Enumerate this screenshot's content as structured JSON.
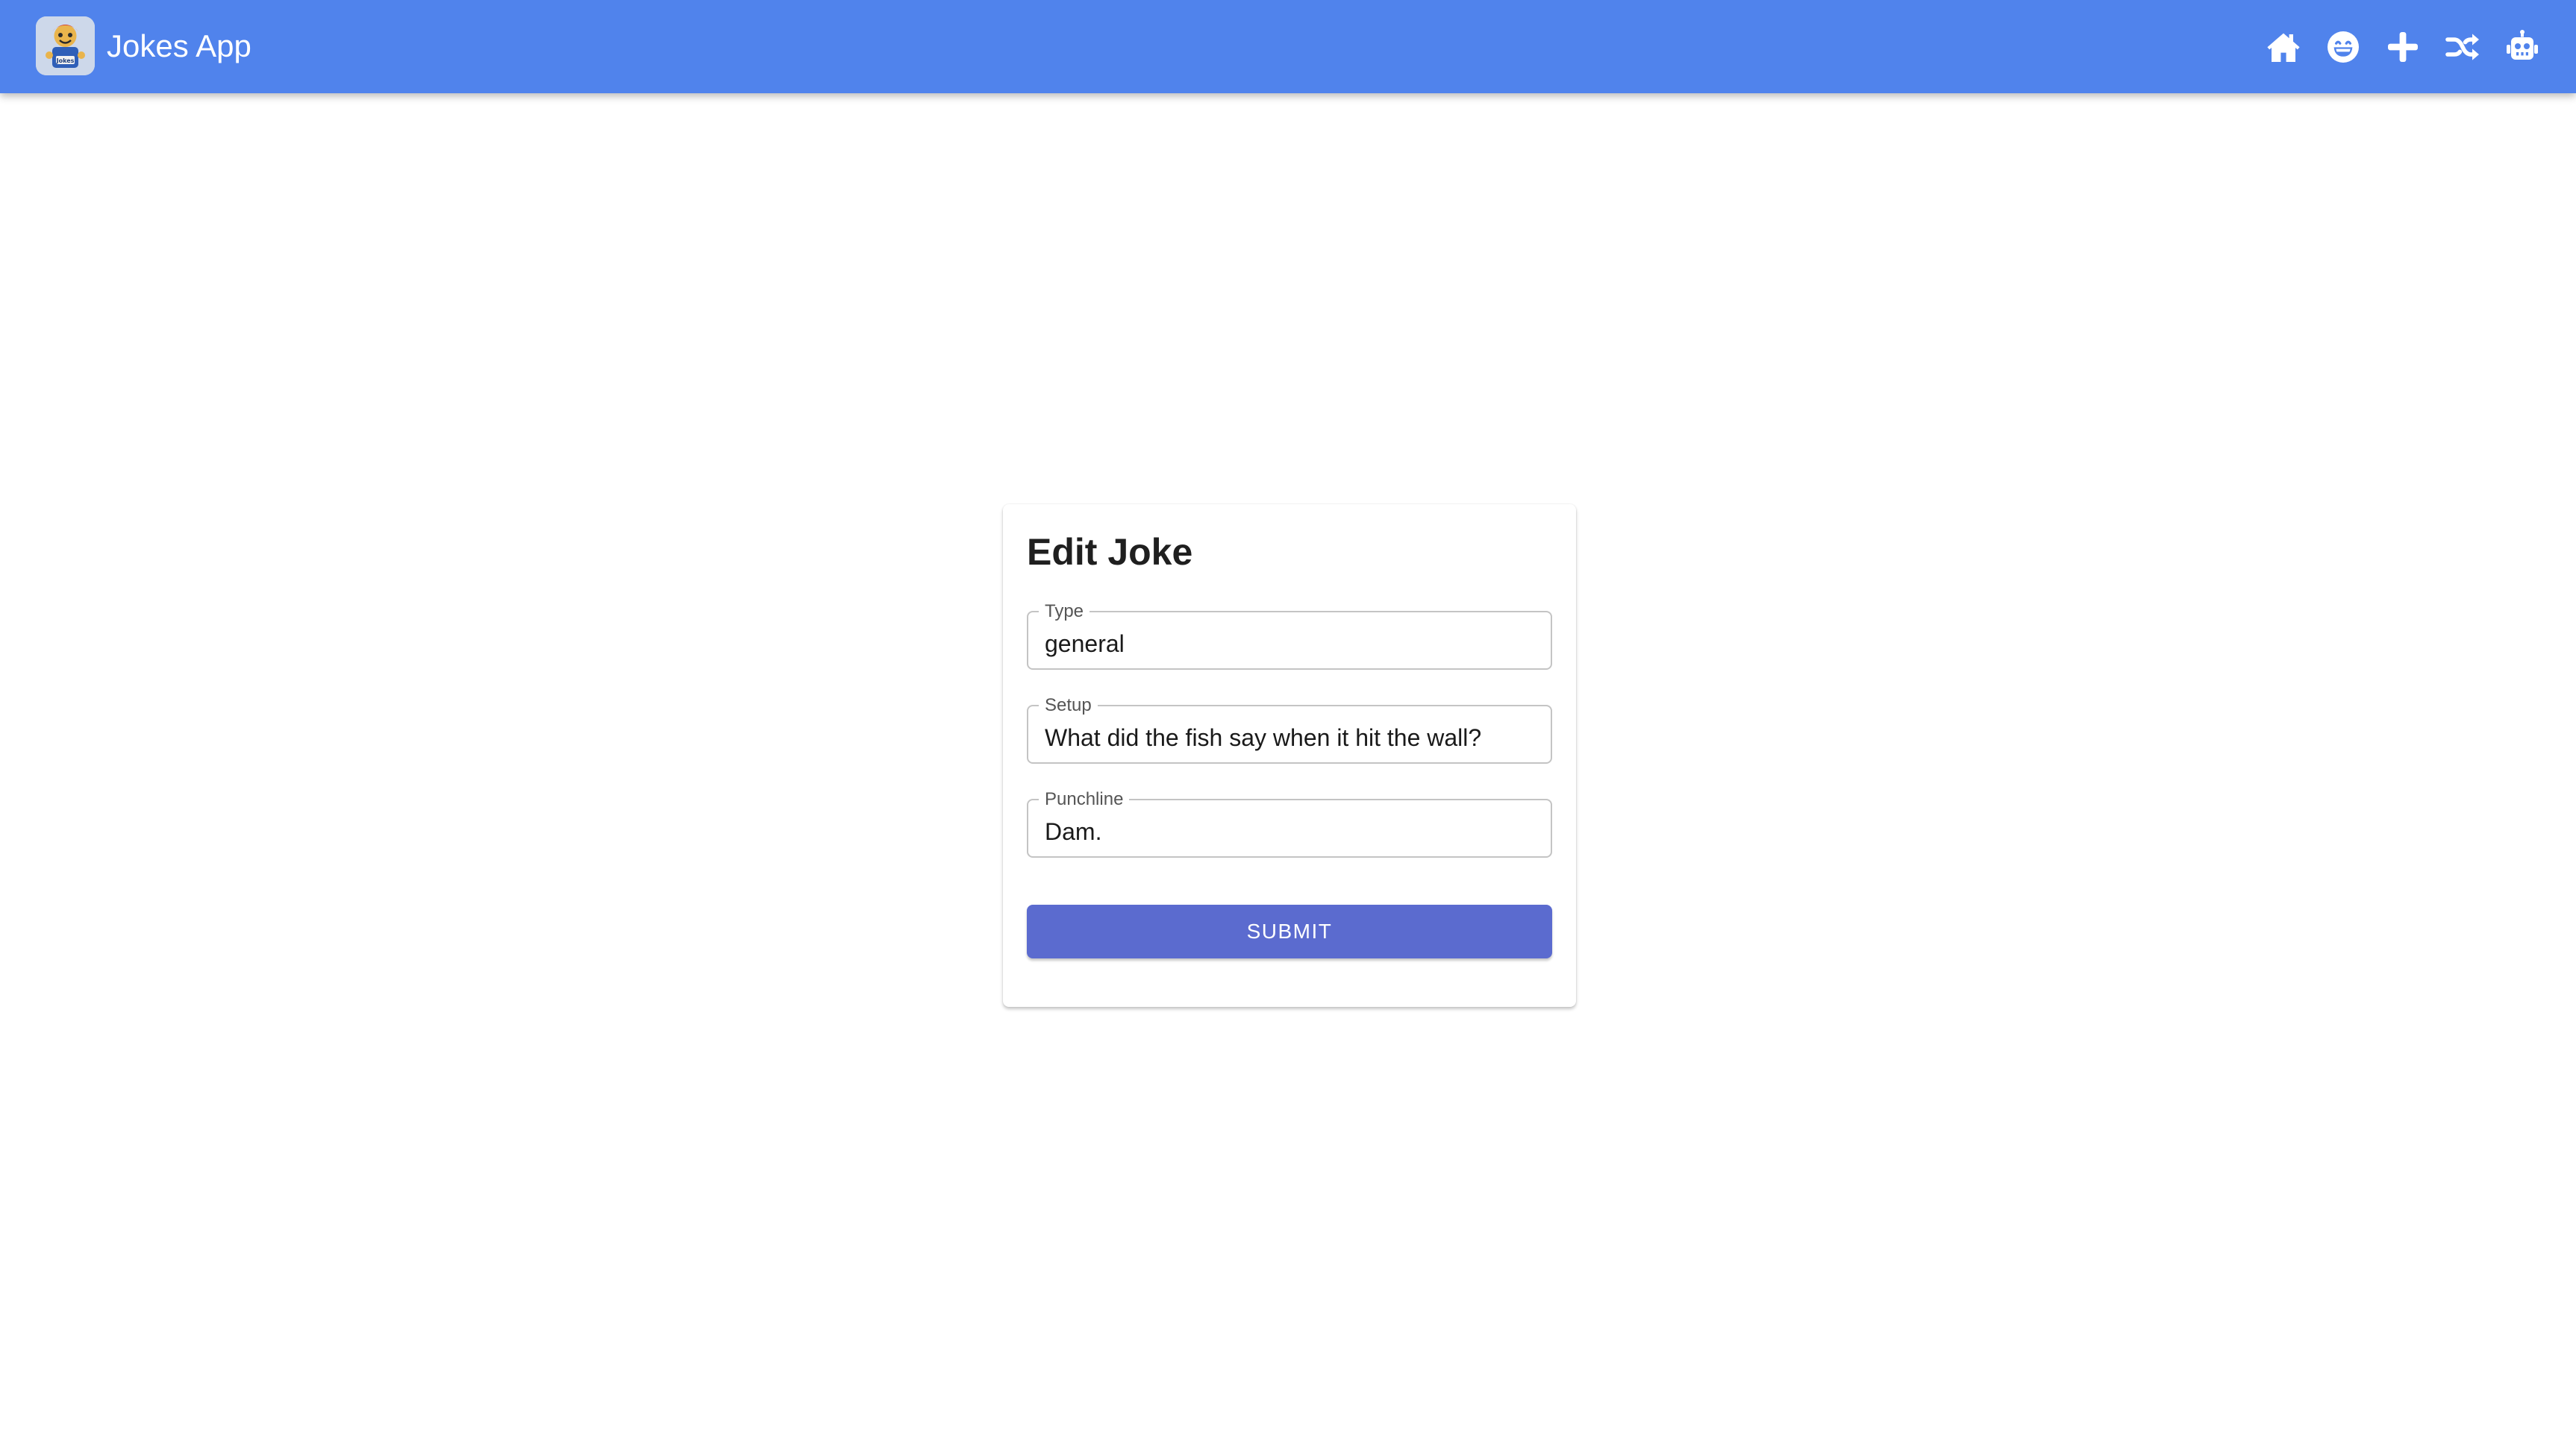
{
  "app": {
    "title": "Jokes App",
    "logo_icon": "jokes-app-logo",
    "nav": [
      {
        "name": "home",
        "icon": "home-icon"
      },
      {
        "name": "jokes",
        "icon": "grin-face-icon"
      },
      {
        "name": "add-joke",
        "icon": "plus-icon"
      },
      {
        "name": "random-joke",
        "icon": "shuffle-icon"
      },
      {
        "name": "ai-joke",
        "icon": "robot-icon"
      }
    ]
  },
  "form": {
    "title": "Edit Joke",
    "fields": {
      "type": {
        "label": "Type",
        "value": "general"
      },
      "setup": {
        "label": "Setup",
        "value": "What did the fish say when it hit the wall?"
      },
      "punchline": {
        "label": "Punchline",
        "value": "Dam."
      }
    },
    "submit_label": "SUBMIT"
  },
  "colors": {
    "appbar": "#5083ec",
    "submit_button": "#5b6bcf",
    "icon": "#ffffff"
  }
}
